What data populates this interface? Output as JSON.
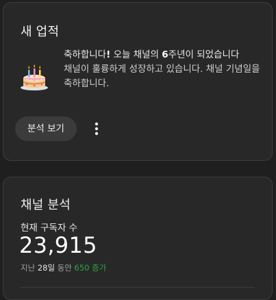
{
  "achievement_card": {
    "title": "새 업적",
    "message_prefix": "축하합니다",
    "message_bang": "!",
    "message_mid": " 오늘 채널의 ",
    "years": "6",
    "message_suffix": "주년이 되었습니다",
    "message_line2": "채널이 훌륭하게 성장하고 있습니다. 채널 기념일을 축하합니다.",
    "analyze_label": "분석 보기",
    "cake_icon": "birthday-cake-icon",
    "more_icon": "more-vert-icon"
  },
  "analytics_card": {
    "title": "채널 분석",
    "subscriber_label": "현재 구독자 수",
    "subscriber_count": "23,915",
    "change_prefix": "지난 ",
    "change_days": "28일",
    "change_mid": " 동안 ",
    "change_value": "650",
    "change_suffix": " 증가"
  },
  "colors": {
    "background": "#1f1f1f",
    "card": "#282828",
    "increase": "#2ba640"
  }
}
